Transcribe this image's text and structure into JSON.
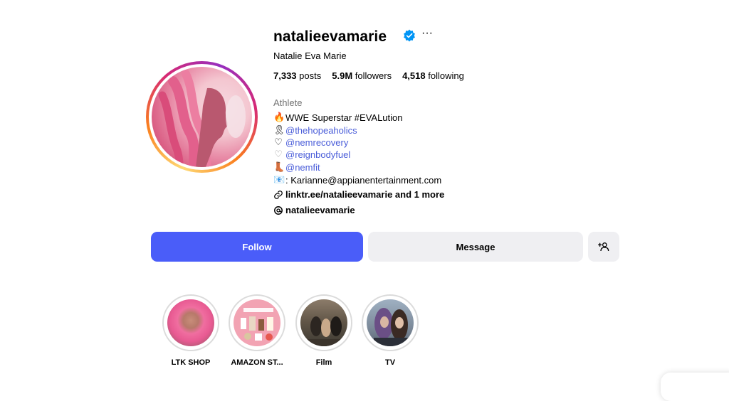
{
  "profile": {
    "username": "natalieevamarie",
    "full_name": "Natalie Eva Marie",
    "verified": true,
    "more_icon": "···"
  },
  "stats": {
    "posts_count": "7,333",
    "posts_label": "posts",
    "followers_count": "5.9M",
    "followers_label": "followers",
    "following_count": "4,518",
    "following_label": "following"
  },
  "bio": {
    "category": "Athlete",
    "line1_emoji": "🔥",
    "line1_text": "WWE Superstar #EVALution",
    "line2_emoji": "🎗",
    "line2_mention": "@thehopeaholics",
    "line3_emoji": "♡",
    "line3_mention": "@nemrecovery",
    "line4_emoji": "♡",
    "line4_mention": "@reignbodyfuel",
    "line5_emoji": "👢",
    "line5_mention": "@nemfit",
    "line6_emoji": "📧",
    "line6_text": ": Karianne@appianentertainment.com",
    "link_text": "linktr.ee/natalieevamarie and 1 more",
    "threads_handle": "natalieevamarie"
  },
  "actions": {
    "follow_label": "Follow",
    "message_label": "Message"
  },
  "highlights": [
    {
      "label": "LTK SHOP"
    },
    {
      "label": "AMAZON ST..."
    },
    {
      "label": "Film"
    },
    {
      "label": "TV"
    }
  ],
  "colors": {
    "accent": "#4a5df9",
    "mention": "#4a5dd9",
    "verified": "#0095f6",
    "secondary_button": "#efeff2"
  }
}
